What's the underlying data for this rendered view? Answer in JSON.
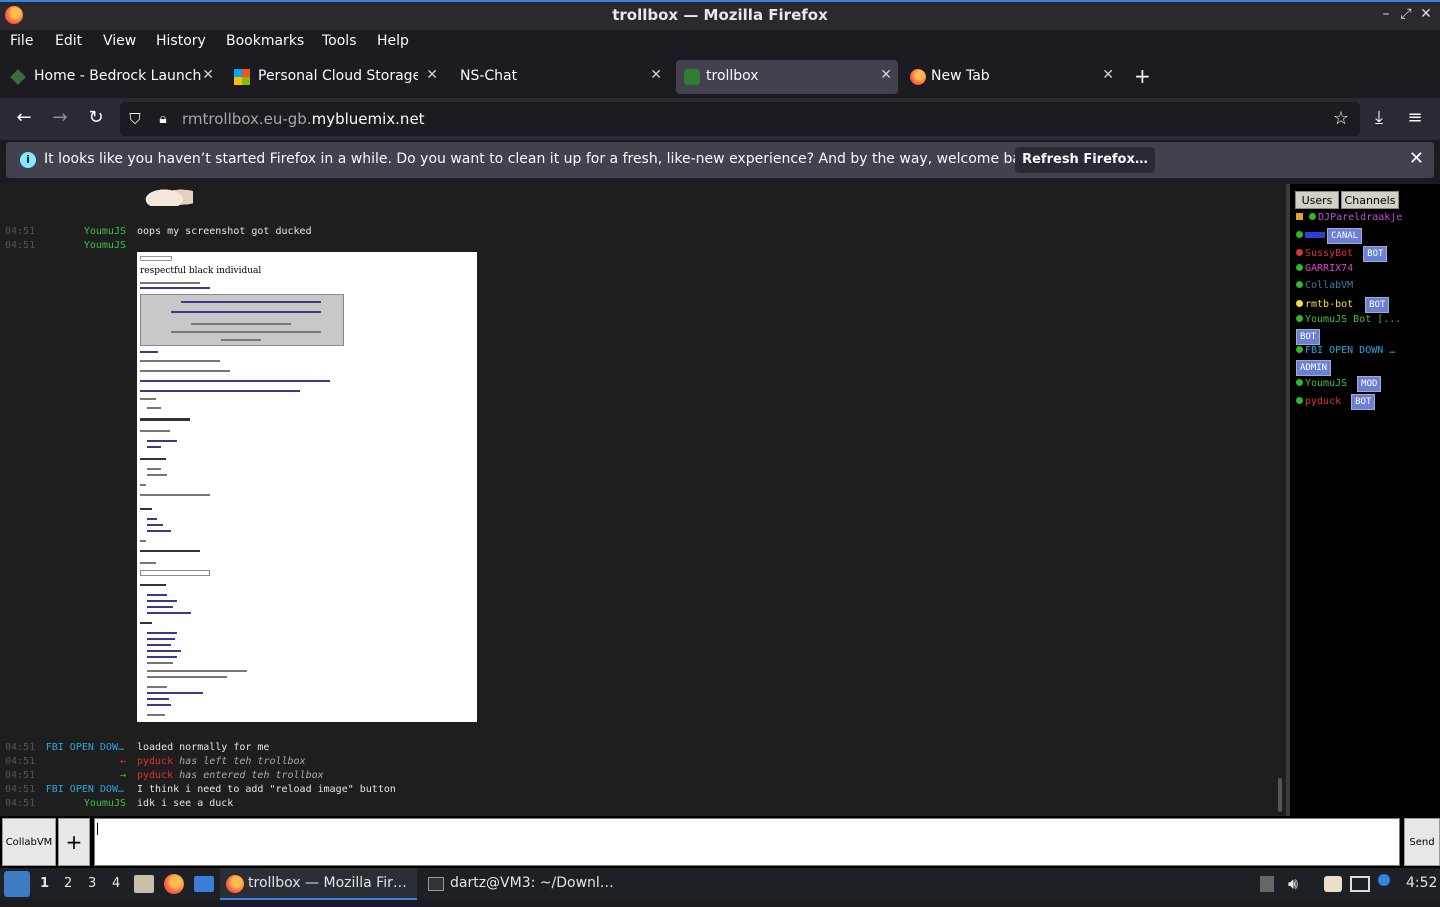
{
  "window": {
    "title": "trollbox — Mozilla Firefox"
  },
  "menu": [
    "File",
    "Edit",
    "View",
    "History",
    "Bookmarks",
    "Tools",
    "Help"
  ],
  "tabs": [
    {
      "label": "Home - Bedrock Launche",
      "icon": "bedrock-icon"
    },
    {
      "label": "Personal Cloud Storage -",
      "icon": "windows-icon"
    },
    {
      "label": "NS-Chat",
      "icon": "none"
    },
    {
      "label": "trollbox",
      "icon": "trollbox-icon"
    },
    {
      "label": "New Tab",
      "icon": "firefox-icon"
    }
  ],
  "url": {
    "prefix": "rmtrollbox.eu-gb.",
    "domain": "mybluemix.net"
  },
  "notification": {
    "message": "It looks like you haven’t started Firefox in a while. Do you want to clean it up for a fresh, like-new experience? And by the way, welcome back!",
    "button": "Refresh Firefox…"
  },
  "chat": {
    "messages": [
      {
        "time": "04:51",
        "nick": "YoumuJS",
        "nick_color": "#3ec23e",
        "text": "oops my screenshot got ducked",
        "italic": false
      },
      {
        "time": "04:51",
        "nick": "YoumuJS",
        "nick_color": "#3ec23e",
        "text": "",
        "italic": false
      },
      {
        "time": "04:51",
        "nick": "FBI OPEN DOW…",
        "nick_color": "#2aa7e0",
        "text": "loaded normally for me",
        "italic": false
      },
      {
        "time": "04:51",
        "nick": "←",
        "nick_color": "#e03030",
        "who": "pyduck",
        "text": "has left teh trollbox",
        "italic": true
      },
      {
        "time": "04:51",
        "nick": "→",
        "nick_color": "#3ec23e",
        "who": "pyduck",
        "text": "has entered teh trollbox",
        "italic": true
      },
      {
        "time": "04:51",
        "nick": "FBI OPEN DOW…",
        "nick_color": "#2aa7e0",
        "text": "I think i need to add \"reload image\" button",
        "italic": false
      },
      {
        "time": "04:51",
        "nick": "YoumuJS",
        "nick_color": "#3ec23e",
        "text": "idk i see a duck",
        "italic": false
      }
    ],
    "screenshot_heading": "respectful black individual"
  },
  "panel": {
    "tabs": [
      "Users",
      "Channels"
    ],
    "users": [
      {
        "name": "DJPareldraakje",
        "color": "#c44fd6",
        "dot": "#2db82d",
        "badge": ""
      },
      {
        "name": "",
        "color": "#2b3fd6",
        "dot": "#2db82d",
        "badge": "CANAL"
      },
      {
        "name": "SussyBot",
        "color": "#e03030",
        "dot": "#e03030",
        "badge": "BOT"
      },
      {
        "name": "GARRIX74",
        "color": "#d946c8",
        "dot": "#2db82d",
        "badge": ""
      },
      {
        "name": "CollabVM",
        "color": "#3a7fa8",
        "dot": "#2db82d",
        "badge": ""
      },
      {
        "name": "rmtb-bot",
        "color": "#f0e040",
        "dot": "#f0e040",
        "badge": "BOT"
      },
      {
        "name": "YoumuJS Bot [...",
        "color": "#3ec23e",
        "dot": "#2db82d",
        "badge": "BOT"
      },
      {
        "name": "FBI OPEN DOWN …",
        "color": "#2aa7e0",
        "dot": "#2db82d",
        "badge": "ADMIN"
      },
      {
        "name": "YoumuJS",
        "color": "#3ec23e",
        "dot": "#2db82d",
        "badge": "MOD"
      },
      {
        "name": "pyduck",
        "color": "#e03030",
        "dot": "#2db82d",
        "badge": "BOT"
      }
    ]
  },
  "input": {
    "user_button": "CollabVM",
    "plus": "+",
    "send": "Send"
  },
  "taskbar": {
    "workspaces": [
      "1",
      "2",
      "3",
      "4"
    ],
    "tasks": [
      "trollbox — Mozilla Fir…",
      "dartz@VM3: ~/Downl…"
    ],
    "clock": "4:52"
  }
}
